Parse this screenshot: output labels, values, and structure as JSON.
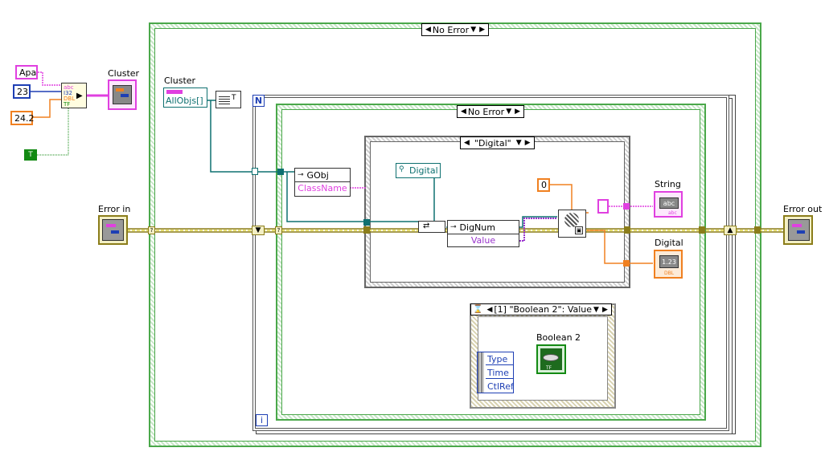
{
  "constants": {
    "apa": "Apa",
    "num23": "23",
    "num24_2": "24.2",
    "bool_t": "T",
    "zero": "0",
    "empty_string": ""
  },
  "bundle_types": [
    "abc",
    "I32",
    "DBL",
    "TF"
  ],
  "labels": {
    "cluster_out": "Cluster",
    "cluster_ref": "Cluster",
    "error_in": "Error in",
    "error_out": "Error out",
    "string_ind": "String",
    "digital_ind": "Digital",
    "boolean2": "Boolean 2"
  },
  "outer_case": {
    "selector": "No Error"
  },
  "for_loop": {
    "count": "N",
    "index": "i"
  },
  "inner_case": {
    "selector": "No Error"
  },
  "class_case": {
    "selector": "\"Digital\""
  },
  "event_struct": {
    "selector": "[1] \"Boolean 2\": Value",
    "items": [
      "Type",
      "Time",
      "CtlRef"
    ]
  },
  "property_nodes": {
    "allobjs": "AllObjs[]",
    "gobj": "GObj",
    "classname": "ClassName",
    "dignum": "DigNum",
    "value": "Value",
    "digital_class": "Digital"
  },
  "indicator_text": {
    "string": "abc",
    "digital": "1.23",
    "dbl": "DBL",
    "tf": "TF",
    "abc": "abc"
  },
  "colors": {
    "case_green": "#2e8b2e",
    "error_wire": "#8b7d1a",
    "string_pink": "#e040e0",
    "int_blue": "#1e3fb4",
    "dbl_orange": "#f08020",
    "ref_teal": "#0e7070",
    "bool_green": "#138a13"
  }
}
